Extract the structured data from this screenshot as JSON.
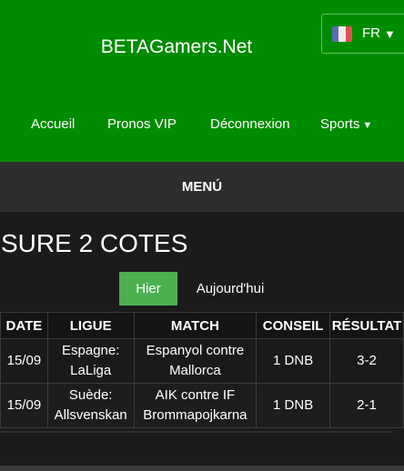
{
  "header": {
    "brand": "BETAGamers.Net",
    "language": {
      "label": "FR",
      "caret": "▼",
      "flag_colors": [
        "#5b6db7",
        "#eeeeee",
        "#e05050"
      ]
    },
    "nav": [
      {
        "label": "Accueil"
      },
      {
        "label": "Pronos VIP"
      },
      {
        "label": "Déconnexion"
      },
      {
        "label": "Sports",
        "caret": "▼"
      }
    ]
  },
  "menu_label": "MENÚ",
  "section_title": "SURE 2 COTES",
  "tabs": {
    "hier": "Hier",
    "today": "Aujourd'hui"
  },
  "table": {
    "headers": [
      "DATE",
      "LIGUE",
      "MATCH",
      "CONSEIL",
      "RÉSULTAT"
    ],
    "rows": [
      {
        "date": "15/09",
        "league_line1": "Espagne:",
        "league_line2": "LaLiga",
        "match_line1": "Espanyol contre",
        "match_line2": "Mallorca",
        "tip": "1 DNB",
        "result": "3-2"
      },
      {
        "date": "15/09",
        "league_line1": "Suède:",
        "league_line2": "Allsvenskan",
        "match_line1": "AIK contre IF",
        "match_line2": "Brommapojkarna",
        "tip": "1 DNB",
        "result": "2-1"
      }
    ]
  },
  "colors": {
    "header_green": "#008c00",
    "active_tab": "#4caf50",
    "menu_bar": "#2e2e2e",
    "page_bg": "#1b1b1b"
  }
}
